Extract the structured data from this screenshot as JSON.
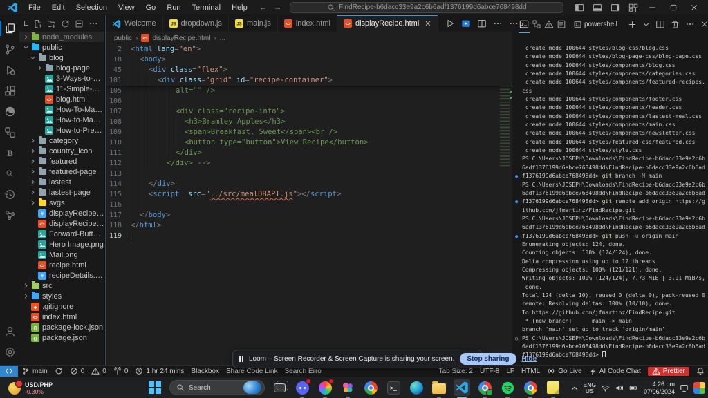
{
  "title_bar": {
    "menus": [
      "File",
      "Edit",
      "Selection",
      "View",
      "Go",
      "Run",
      "Terminal",
      "Help"
    ],
    "search_value": "FindRecipe-b6dacc33e9a2c6b6adf1376199d6abce768498dd",
    "layout_icons": [
      "layout-left",
      "layout-bottom",
      "layout-right",
      "layout-grid"
    ],
    "window_icons": [
      "minimize",
      "maximize",
      "close"
    ]
  },
  "activity_bar": {
    "top": [
      {
        "name": "explorer",
        "icon": "files",
        "active": true
      },
      {
        "name": "source-control",
        "icon": "scm"
      },
      {
        "name": "run-debug",
        "icon": "debug"
      },
      {
        "name": "extensions",
        "icon": "extensions"
      },
      {
        "name": "edge-browser",
        "icon": "edge"
      },
      {
        "name": "remote-explorer",
        "icon": "remote"
      },
      {
        "name": "blackbox",
        "icon": "blackbox"
      },
      {
        "name": "search",
        "icon": "search"
      },
      {
        "name": "history",
        "icon": "history"
      },
      {
        "name": "live-share",
        "icon": "share"
      }
    ],
    "bottom": [
      {
        "name": "account",
        "icon": "account"
      },
      {
        "name": "settings",
        "icon": "gear"
      }
    ]
  },
  "explorer": {
    "title": "E",
    "actions": [
      "new-file",
      "new-folder",
      "refresh",
      "collapse-all",
      "more"
    ],
    "items": [
      {
        "l": "node_modules",
        "ic": "folder-npm",
        "d": 0,
        "c": "r",
        "dim": true,
        "sel": true
      },
      {
        "l": "public",
        "ic": "folder-public",
        "d": 0,
        "c": "d"
      },
      {
        "l": "blog",
        "ic": "folder-plain",
        "d": 1,
        "c": "d"
      },
      {
        "l": "blog-page",
        "ic": "folder-plain",
        "d": 2,
        "c": "r"
      },
      {
        "l": "3-Ways-to-Pre...",
        "ic": "image",
        "d": 2
      },
      {
        "l": "11-Simple-Wa...",
        "ic": "image",
        "d": 2
      },
      {
        "l": "blog.html",
        "ic": "html",
        "d": 2
      },
      {
        "l": "How-To-Make-...",
        "ic": "image",
        "d": 2
      },
      {
        "l": "How-to-Make-...",
        "ic": "image",
        "d": 2
      },
      {
        "l": "How-to-Preser...",
        "ic": "image",
        "d": 2
      },
      {
        "l": "category",
        "ic": "folder-plain",
        "d": 1,
        "c": "r"
      },
      {
        "l": "country_icon",
        "ic": "folder-plain",
        "d": 1,
        "c": "r"
      },
      {
        "l": "featured",
        "ic": "folder-plain",
        "d": 1,
        "c": "r"
      },
      {
        "l": "featured-page",
        "ic": "folder-plain",
        "d": 1,
        "c": "r"
      },
      {
        "l": "lastest",
        "ic": "folder-plain",
        "d": 1,
        "c": "r"
      },
      {
        "l": "lastest-page",
        "ic": "folder-plain",
        "d": 1,
        "c": "r"
      },
      {
        "l": "svgs",
        "ic": "folder-svg",
        "d": 1,
        "c": "r"
      },
      {
        "l": "displayRecipe.css",
        "ic": "css",
        "d": 1
      },
      {
        "l": "displayRecipe.ht...",
        "ic": "html",
        "d": 1
      },
      {
        "l": "Forward-Button....",
        "ic": "image",
        "d": 1
      },
      {
        "l": "Hero Image.png",
        "ic": "image",
        "d": 1
      },
      {
        "l": "Mail.png",
        "ic": "image",
        "d": 1
      },
      {
        "l": "recipe.html",
        "ic": "html",
        "d": 1
      },
      {
        "l": "recipeDetails.css",
        "ic": "css",
        "d": 1
      },
      {
        "l": "src",
        "ic": "folder-src",
        "d": 0,
        "c": "r"
      },
      {
        "l": "styles",
        "ic": "folder-styles",
        "d": 0,
        "c": "r"
      },
      {
        "l": ".gitignore",
        "ic": "git",
        "d": 0
      },
      {
        "l": "index.html",
        "ic": "html",
        "d": 0
      },
      {
        "l": "package-lock.json",
        "ic": "json",
        "d": 0
      },
      {
        "l": "package.json",
        "ic": "json",
        "d": 0
      }
    ]
  },
  "editor": {
    "tabs": [
      {
        "label": "Welcome",
        "icon": "vscode-small"
      },
      {
        "label": "dropdown.js",
        "icon": "js"
      },
      {
        "label": "main.js",
        "icon": "js"
      },
      {
        "label": "index.html",
        "icon": "html"
      },
      {
        "label": "displayRecipe.html",
        "icon": "html",
        "active": true,
        "close": true
      }
    ],
    "actions": [
      "run",
      "live-preview",
      "split-editor",
      "more"
    ],
    "breadcrumb": [
      {
        "label": "public"
      },
      {
        "label": "displayRecipe.html",
        "icon": "html"
      },
      {
        "label": "..."
      }
    ],
    "sticky": [
      {
        "n": "2",
        "i": 0,
        "s": [
          [
            "p",
            "<"
          ],
          [
            "t",
            "html"
          ],
          [
            "w",
            " "
          ],
          [
            "a",
            "lang"
          ],
          [
            "p",
            "="
          ],
          [
            "s",
            "\"en\""
          ],
          [
            "p",
            ">"
          ]
        ]
      },
      {
        "n": "18",
        "i": 1,
        "s": [
          [
            "p",
            "<"
          ],
          [
            "t",
            "body"
          ],
          [
            "p",
            ">"
          ]
        ]
      },
      {
        "n": "45",
        "i": 2,
        "s": [
          [
            "p",
            "<"
          ],
          [
            "t",
            "div"
          ],
          [
            "w",
            " "
          ],
          [
            "a",
            "class"
          ],
          [
            "p",
            "="
          ],
          [
            "s",
            "\"flex\""
          ],
          [
            "p",
            ">"
          ]
        ]
      },
      {
        "n": "101",
        "i": 3,
        "s": [
          [
            "p",
            "<"
          ],
          [
            "t",
            "div"
          ],
          [
            "w",
            " "
          ],
          [
            "a",
            "class"
          ],
          [
            "p",
            "="
          ],
          [
            "s",
            "\"grid\""
          ],
          [
            "w",
            " "
          ],
          [
            "a",
            "id"
          ],
          [
            "p",
            "="
          ],
          [
            "s",
            "\"recipe-container\""
          ],
          [
            "p",
            ">"
          ]
        ]
      }
    ],
    "lines": [
      {
        "n": "105",
        "i": 5,
        "s": [
          [
            "c",
            "alt=\"\" />"
          ]
        ]
      },
      {
        "n": "106",
        "i": 5,
        "s": []
      },
      {
        "n": "107",
        "i": 5,
        "s": [
          [
            "c",
            "<div class=\"recipe-info\">"
          ]
        ]
      },
      {
        "n": "108",
        "i": 6,
        "s": [
          [
            "c",
            "<h3>Bramley Apples</h3>"
          ]
        ]
      },
      {
        "n": "109",
        "i": 6,
        "s": [
          [
            "c",
            "<span>Breakfast, Sweet</span><br />"
          ]
        ]
      },
      {
        "n": "110",
        "i": 6,
        "s": [
          [
            "c",
            "<button type=\"button\">View Recipe</button>"
          ]
        ]
      },
      {
        "n": "111",
        "i": 5,
        "s": [
          [
            "c",
            "</div>"
          ]
        ]
      },
      {
        "n": "112",
        "i": 4,
        "s": [
          [
            "c",
            "</div> -->"
          ]
        ]
      },
      {
        "n": "113",
        "i": 2,
        "s": []
      },
      {
        "n": "114",
        "i": 2,
        "s": [
          [
            "p",
            "</"
          ],
          [
            "t",
            "div"
          ],
          [
            "p",
            ">"
          ]
        ]
      },
      {
        "n": "115",
        "i": 2,
        "s": [
          [
            "p",
            "<"
          ],
          [
            "t",
            "script"
          ],
          [
            "w",
            "  "
          ],
          [
            "a",
            "src"
          ],
          [
            "p",
            "="
          ],
          [
            "s",
            "\""
          ],
          [
            "sq",
            "../src/mealDBAPI.js"
          ],
          [
            "s",
            "\""
          ],
          [
            "p",
            "></"
          ],
          [
            "t",
            "script"
          ],
          [
            "p",
            ">"
          ]
        ]
      },
      {
        "n": "116",
        "i": 2,
        "s": []
      },
      {
        "n": "117",
        "i": 1,
        "s": [
          [
            "p",
            "</"
          ],
          [
            "t",
            "body"
          ],
          [
            "p",
            ">"
          ]
        ]
      },
      {
        "n": "118",
        "i": 0,
        "s": [
          [
            "p",
            "</"
          ],
          [
            "t",
            "html"
          ],
          [
            "p",
            ">"
          ]
        ]
      },
      {
        "n": "119",
        "i": 0,
        "s": [],
        "cur": true
      }
    ]
  },
  "terminal": {
    "tabs": [
      {
        "icon": "terminal-tab",
        "active": true
      },
      {
        "icon": "panels-tab"
      },
      {
        "icon": "problems-tab"
      },
      {
        "icon": "output-tab"
      }
    ],
    "title": "powershell",
    "actions": [
      "plus",
      "chevron-down",
      "split-editor",
      "trash",
      "more",
      "close"
    ],
    "lines": [
      {
        "t": " create mode 100644 styles/blog-css/blog.css"
      },
      {
        "t": " create mode 100644 styles/blog-page-css/blog-page.css"
      },
      {
        "t": " create mode 100644 styles/components/blog.css"
      },
      {
        "t": " create mode 100644 styles/components/categories.css"
      },
      {
        "t": " create mode 100644 styles/components/featured-recipes."
      },
      {
        "t": "css"
      },
      {
        "t": " create mode 100644 styles/components/footer.css"
      },
      {
        "t": " create mode 100644 styles/components/header.css"
      },
      {
        "t": " create mode 100644 styles/components/lastest-meal.css"
      },
      {
        "t": " create mode 100644 styles/components/main.css"
      },
      {
        "t": " create mode 100644 styles/components/newsletter.css"
      },
      {
        "t": " create mode 100644 styles/featured-css/featured.css"
      },
      {
        "t": " create mode 100644 styles/style.css"
      },
      {
        "t": "PS C:\\Users\\JOSEPH\\Downloads\\FindRecipe-b6dacc33e9a2c6b"
      },
      {
        "t": "6adf1376199d6abce768498dd\\FindRecipe-b6dacc33e9a2c6b6ad"
      },
      {
        "b": "dot",
        "t": [
          [
            "",
            "f1376199d6abce768498dd> "
          ],
          [
            "cmd",
            "git"
          ],
          [
            "",
            " branch "
          ],
          [
            "prm",
            "-M"
          ],
          [
            "",
            " main"
          ]
        ]
      },
      {
        "t": "PS C:\\Users\\JOSEPH\\Downloads\\FindRecipe-b6dacc33e9a2c6b"
      },
      {
        "t": "6adf1376199d6abce768498dd\\FindRecipe-b6dacc33e9a2c6b6ad"
      },
      {
        "b": "dot",
        "t": [
          [
            "",
            "f1376199d6abce768498dd> "
          ],
          [
            "cmd",
            "git"
          ],
          [
            "",
            " remote add origin https://g"
          ]
        ]
      },
      {
        "t": "ithub.com/jfmartinz/FindRecipe.git"
      },
      {
        "t": "PS C:\\Users\\JOSEPH\\Downloads\\FindRecipe-b6dacc33e9a2c6b"
      },
      {
        "t": "6adf1376199d6abce768498dd\\FindRecipe-b6dacc33e9a2c6b6ad"
      },
      {
        "b": "dot",
        "t": [
          [
            "",
            "f1376199d6abce768498dd> "
          ],
          [
            "cmd",
            "git"
          ],
          [
            "",
            " push "
          ],
          [
            "prm",
            "-u"
          ],
          [
            "",
            " origin main"
          ]
        ]
      },
      {
        "t": "Enumerating objects: 124, done."
      },
      {
        "t": "Counting objects: 100% (124/124), done."
      },
      {
        "t": "Delta compression using up to 12 threads"
      },
      {
        "t": "Compressing objects: 100% (121/121), done."
      },
      {
        "t": "Writing objects: 100% (124/124), 7.73 MiB | 3.01 MiB/s,"
      },
      {
        "t": " done."
      },
      {
        "t": "Total 124 (delta 10), reused 0 (delta 0), pack-reused 0"
      },
      {
        "t": "remote: Resolving deltas: 100% (10/10), done."
      },
      {
        "t": "To https://github.com/jfmartinz/FindRecipe.git"
      },
      {
        "t": " * [new branch]      main -> main"
      },
      {
        "t": "branch 'main' set up to track 'origin/main'."
      },
      {
        "b": "ring",
        "t": "PS C:\\Users\\JOSEPH\\Downloads\\FindRecipe-b6dacc33e9a2c6b"
      },
      {
        "t": "6adf1376199d6abce768498dd\\FindRecipe-b6dacc33e9a2c6b6ad"
      },
      {
        "t": [
          [
            "",
            "f1376199d6abce768498dd> "
          ],
          [
            "cur",
            ""
          ]
        ]
      }
    ]
  },
  "status_bar": {
    "left": [
      {
        "name": "remote",
        "icon": "remote-window",
        "chip": true
      },
      {
        "name": "branch",
        "icon": "branch",
        "label": "main"
      },
      {
        "name": "sync",
        "icon": "sync"
      },
      {
        "name": "errors",
        "icon": "error",
        "label": "0"
      },
      {
        "name": "warnings",
        "icon": "warning",
        "label": "0"
      },
      {
        "name": "ports",
        "icon": "antenna",
        "label": "0"
      },
      {
        "name": "timer",
        "icon": "clock",
        "label": "1 hr 24 mins"
      },
      {
        "name": "blackbox",
        "label": "Blackbox"
      },
      {
        "name": "share-code-link",
        "label": "Share Code Link"
      },
      {
        "name": "search-error",
        "label": "Search Erro"
      }
    ],
    "right": [
      {
        "name": "tab-size",
        "label": "Tab Size: 2"
      },
      {
        "name": "encoding",
        "label": "UTF-8"
      },
      {
        "name": "eol",
        "label": "LF"
      },
      {
        "name": "language-mode",
        "label": "HTML"
      },
      {
        "name": "go-live",
        "icon": "broadcast",
        "label": "Go Live"
      },
      {
        "name": "ai-code-chat",
        "icon": "flash",
        "label": "AI Code Chat"
      },
      {
        "name": "prettier",
        "icon": "warning",
        "label": "Prettier",
        "red": true
      },
      {
        "name": "notifications",
        "icon": "bell"
      }
    ]
  },
  "loom": {
    "text": "Loom – Screen Recorder & Screen Capture is sharing your screen.",
    "stop_label": "Stop sharing",
    "hide_label": "Hide"
  },
  "taskbar": {
    "widget": {
      "pair": "USD/PHP",
      "change": "-0.30%"
    },
    "search_placeholder": "Search",
    "apps": [
      {
        "name": "task-view",
        "icon": "taskview"
      },
      {
        "name": "chat-app",
        "icon": "discord",
        "badge": true,
        "dot": true
      },
      {
        "name": "color-app",
        "icon": "rainbow",
        "badge": true,
        "dot": true
      },
      {
        "name": "photos-app",
        "icon": "flower",
        "dot": true
      },
      {
        "name": "chrome",
        "icon": "chrome"
      },
      {
        "name": "terminal-app",
        "icon": "termapp"
      },
      {
        "name": "edge",
        "icon": "edgeapp"
      },
      {
        "name": "file-explorer",
        "icon": "folderapp",
        "dot": true
      },
      {
        "name": "vscode",
        "icon": "vscodeapp",
        "active": true
      },
      {
        "name": "chrome-profile",
        "icon": "chromeclock",
        "dot": true
      },
      {
        "name": "spotify",
        "icon": "spotify",
        "dot": true
      },
      {
        "name": "chrome-2",
        "icon": "chrome",
        "dot": true
      },
      {
        "name": "sticky-notes",
        "icon": "notes",
        "dot": true
      }
    ],
    "tray": {
      "icons_left": [
        "chevron-up"
      ],
      "lang_line1": "ENG",
      "lang_line2": "US",
      "icons_mid": [
        "wifi",
        "volume",
        "battery"
      ],
      "time": "4:26 pm",
      "date": "07/06/2024",
      "icons_right": [
        "monitor",
        "photos"
      ]
    }
  }
}
